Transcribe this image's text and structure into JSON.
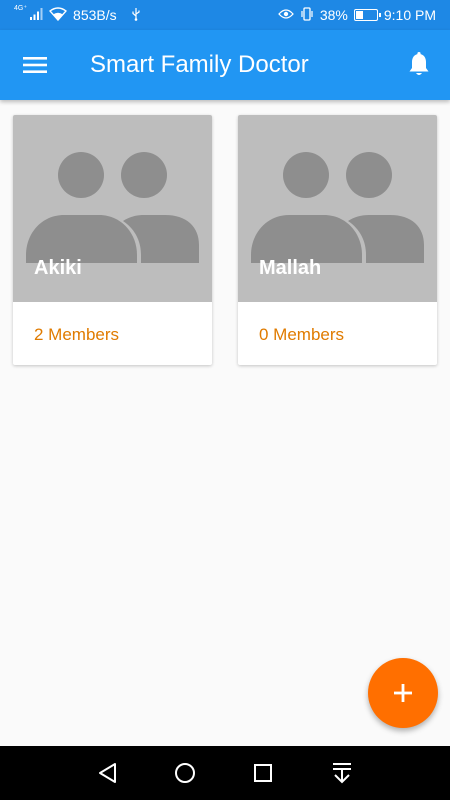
{
  "status_bar": {
    "network_type": "4G⁺",
    "speed": "853B/s",
    "battery": "38%",
    "battery_level": 0.38,
    "time": "9:10 PM"
  },
  "app_bar": {
    "title": "Smart Family Doctor",
    "menu_icon": "hamburger-menu-icon",
    "notification_icon": "bell-icon",
    "color": "#2196f3"
  },
  "families": [
    {
      "name": "Akiki",
      "members": "2 Members",
      "icon": "group-icon"
    },
    {
      "name": "Mallah",
      "members": "0 Members",
      "icon": "group-icon"
    }
  ],
  "fab": {
    "icon": "plus-icon",
    "color": "#ff6f00"
  },
  "nav_bar": {
    "back_icon": "back-triangle-icon",
    "home_icon": "home-circle-icon",
    "recents_icon": "recents-square-icon",
    "notifications_icon": "pull-down-notifications-icon"
  }
}
